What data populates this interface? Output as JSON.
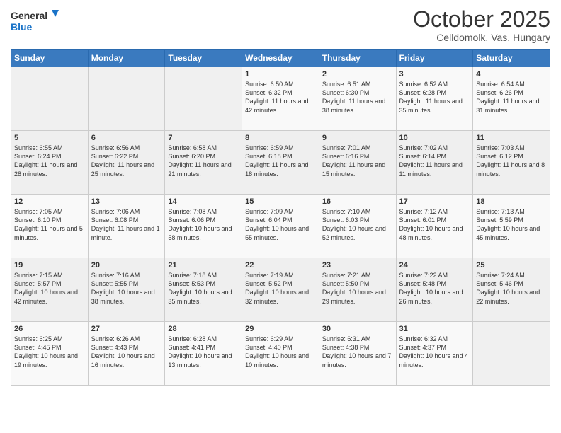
{
  "logo": {
    "line1": "General",
    "line2": "Blue"
  },
  "title": "October 2025",
  "subtitle": "Celldomolk, Vas, Hungary",
  "days_header": [
    "Sunday",
    "Monday",
    "Tuesday",
    "Wednesday",
    "Thursday",
    "Friday",
    "Saturday"
  ],
  "weeks": [
    [
      {
        "day": "",
        "info": ""
      },
      {
        "day": "",
        "info": ""
      },
      {
        "day": "",
        "info": ""
      },
      {
        "day": "1",
        "info": "Sunrise: 6:50 AM\nSunset: 6:32 PM\nDaylight: 11 hours\nand 42 minutes."
      },
      {
        "day": "2",
        "info": "Sunrise: 6:51 AM\nSunset: 6:30 PM\nDaylight: 11 hours\nand 38 minutes."
      },
      {
        "day": "3",
        "info": "Sunrise: 6:52 AM\nSunset: 6:28 PM\nDaylight: 11 hours\nand 35 minutes."
      },
      {
        "day": "4",
        "info": "Sunrise: 6:54 AM\nSunset: 6:26 PM\nDaylight: 11 hours\nand 31 minutes."
      }
    ],
    [
      {
        "day": "5",
        "info": "Sunrise: 6:55 AM\nSunset: 6:24 PM\nDaylight: 11 hours\nand 28 minutes."
      },
      {
        "day": "6",
        "info": "Sunrise: 6:56 AM\nSunset: 6:22 PM\nDaylight: 11 hours\nand 25 minutes."
      },
      {
        "day": "7",
        "info": "Sunrise: 6:58 AM\nSunset: 6:20 PM\nDaylight: 11 hours\nand 21 minutes."
      },
      {
        "day": "8",
        "info": "Sunrise: 6:59 AM\nSunset: 6:18 PM\nDaylight: 11 hours\nand 18 minutes."
      },
      {
        "day": "9",
        "info": "Sunrise: 7:01 AM\nSunset: 6:16 PM\nDaylight: 11 hours\nand 15 minutes."
      },
      {
        "day": "10",
        "info": "Sunrise: 7:02 AM\nSunset: 6:14 PM\nDaylight: 11 hours\nand 11 minutes."
      },
      {
        "day": "11",
        "info": "Sunrise: 7:03 AM\nSunset: 6:12 PM\nDaylight: 11 hours\nand 8 minutes."
      }
    ],
    [
      {
        "day": "12",
        "info": "Sunrise: 7:05 AM\nSunset: 6:10 PM\nDaylight: 11 hours\nand 5 minutes."
      },
      {
        "day": "13",
        "info": "Sunrise: 7:06 AM\nSunset: 6:08 PM\nDaylight: 11 hours\nand 1 minute."
      },
      {
        "day": "14",
        "info": "Sunrise: 7:08 AM\nSunset: 6:06 PM\nDaylight: 10 hours\nand 58 minutes."
      },
      {
        "day": "15",
        "info": "Sunrise: 7:09 AM\nSunset: 6:04 PM\nDaylight: 10 hours\nand 55 minutes."
      },
      {
        "day": "16",
        "info": "Sunrise: 7:10 AM\nSunset: 6:03 PM\nDaylight: 10 hours\nand 52 minutes."
      },
      {
        "day": "17",
        "info": "Sunrise: 7:12 AM\nSunset: 6:01 PM\nDaylight: 10 hours\nand 48 minutes."
      },
      {
        "day": "18",
        "info": "Sunrise: 7:13 AM\nSunset: 5:59 PM\nDaylight: 10 hours\nand 45 minutes."
      }
    ],
    [
      {
        "day": "19",
        "info": "Sunrise: 7:15 AM\nSunset: 5:57 PM\nDaylight: 10 hours\nand 42 minutes."
      },
      {
        "day": "20",
        "info": "Sunrise: 7:16 AM\nSunset: 5:55 PM\nDaylight: 10 hours\nand 38 minutes."
      },
      {
        "day": "21",
        "info": "Sunrise: 7:18 AM\nSunset: 5:53 PM\nDaylight: 10 hours\nand 35 minutes."
      },
      {
        "day": "22",
        "info": "Sunrise: 7:19 AM\nSunset: 5:52 PM\nDaylight: 10 hours\nand 32 minutes."
      },
      {
        "day": "23",
        "info": "Sunrise: 7:21 AM\nSunset: 5:50 PM\nDaylight: 10 hours\nand 29 minutes."
      },
      {
        "day": "24",
        "info": "Sunrise: 7:22 AM\nSunset: 5:48 PM\nDaylight: 10 hours\nand 26 minutes."
      },
      {
        "day": "25",
        "info": "Sunrise: 7:24 AM\nSunset: 5:46 PM\nDaylight: 10 hours\nand 22 minutes."
      }
    ],
    [
      {
        "day": "26",
        "info": "Sunrise: 6:25 AM\nSunset: 4:45 PM\nDaylight: 10 hours\nand 19 minutes."
      },
      {
        "day": "27",
        "info": "Sunrise: 6:26 AM\nSunset: 4:43 PM\nDaylight: 10 hours\nand 16 minutes."
      },
      {
        "day": "28",
        "info": "Sunrise: 6:28 AM\nSunset: 4:41 PM\nDaylight: 10 hours\nand 13 minutes."
      },
      {
        "day": "29",
        "info": "Sunrise: 6:29 AM\nSunset: 4:40 PM\nDaylight: 10 hours\nand 10 minutes."
      },
      {
        "day": "30",
        "info": "Sunrise: 6:31 AM\nSunset: 4:38 PM\nDaylight: 10 hours\nand 7 minutes."
      },
      {
        "day": "31",
        "info": "Sunrise: 6:32 AM\nSunset: 4:37 PM\nDaylight: 10 hours\nand 4 minutes."
      },
      {
        "day": "",
        "info": ""
      }
    ]
  ]
}
